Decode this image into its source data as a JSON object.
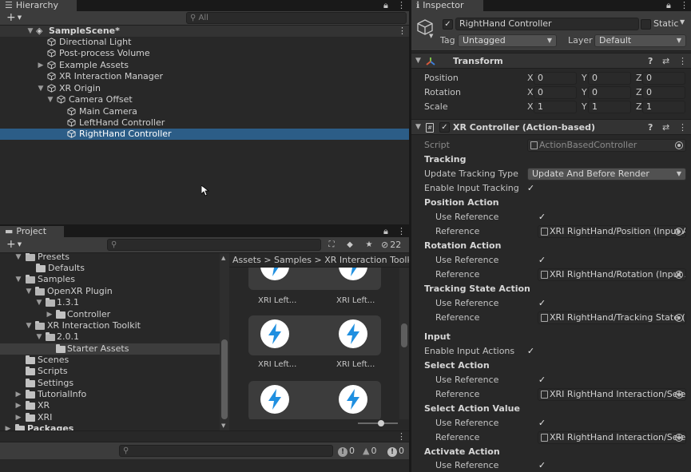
{
  "hierarchy": {
    "tab": "Hierarchy",
    "add_label": "+",
    "search_placeholder": "All",
    "items": [
      {
        "label": "SampleScene*"
      },
      {
        "label": "Directional Light"
      },
      {
        "label": "Post-process Volume"
      },
      {
        "label": "Example Assets"
      },
      {
        "label": "XR Interaction Manager"
      },
      {
        "label": "XR Origin"
      },
      {
        "label": "Camera Offset"
      },
      {
        "label": "Main Camera"
      },
      {
        "label": "LeftHand Controller"
      },
      {
        "label": "RightHand Controller"
      }
    ]
  },
  "project": {
    "tab": "Project",
    "add_label": "+",
    "hidden_count": "22",
    "breadcrumb": [
      "Assets",
      "Samples",
      "XR Interaction Toolkit"
    ],
    "tree": [
      {
        "label": "Presets"
      },
      {
        "label": "Defaults"
      },
      {
        "label": "Samples"
      },
      {
        "label": "OpenXR Plugin"
      },
      {
        "label": "1.3.1"
      },
      {
        "label": "Controller"
      },
      {
        "label": "XR Interaction Toolkit"
      },
      {
        "label": "2.0.1"
      },
      {
        "label": "Starter Assets"
      },
      {
        "label": "Scenes"
      },
      {
        "label": "Scripts"
      },
      {
        "label": "Settings"
      },
      {
        "label": "TutorialInfo"
      },
      {
        "label": "XR"
      },
      {
        "label": "XRI"
      },
      {
        "label": "Packages"
      }
    ],
    "assets": [
      {
        "label": "XRI Left..."
      },
      {
        "label": "XRI Left..."
      },
      {
        "label": "XRI Left..."
      },
      {
        "label": "XRI Left..."
      }
    ]
  },
  "console": {
    "info_count": "0",
    "warn_count": "0",
    "error_count": "0"
  },
  "inspector": {
    "tab": "Inspector",
    "object_name": "RightHand Controller",
    "static_label": "Static",
    "tag_label": "Tag",
    "tag_value": "Untagged",
    "layer_label": "Layer",
    "layer_value": "Default",
    "transform": {
      "title": "Transform",
      "position_label": "Position",
      "rotation_label": "Rotation",
      "scale_label": "Scale",
      "x": "X",
      "y": "Y",
      "z": "Z",
      "position": [
        "0",
        "0",
        "0"
      ],
      "rotation": [
        "0",
        "0",
        "0"
      ],
      "scale": [
        "1",
        "1",
        "1"
      ]
    },
    "xr_controller": {
      "title": "XR Controller (Action-based)",
      "script_label": "Script",
      "script_value": "ActionBasedController",
      "tracking_header": "Tracking",
      "update_tracking_label": "Update Tracking Type",
      "update_tracking_value": "Update And Before Render",
      "enable_input_tracking_label": "Enable Input Tracking",
      "position_action": "Position Action",
      "rotation_action": "Rotation Action",
      "tracking_state_action": "Tracking State Action",
      "use_reference_label": "Use Reference",
      "reference_label": "Reference",
      "position_ref": "XRI RightHand/Position (Input Action Reference)",
      "rotation_ref": "XRI RightHand/Rotation (Input Action Reference)",
      "tracking_state_ref": "XRI RightHand/Tracking State (Input Action Reference)",
      "input_header": "Input",
      "enable_input_actions_label": "Enable Input Actions",
      "select_action": "Select Action",
      "select_ref": "XRI RightHand Interaction/Select (Input Action Reference)",
      "select_value_action": "Select Action Value",
      "select_value_ref": "XRI RightHand Interaction/Select Value (Input Action Reference)",
      "activate_action": "Activate Action"
    }
  },
  "colors": {
    "selection": "#2c5d87",
    "panel": "#282828",
    "toolbar": "#3c3c3c",
    "asset_icon": "#1f8fe0"
  }
}
